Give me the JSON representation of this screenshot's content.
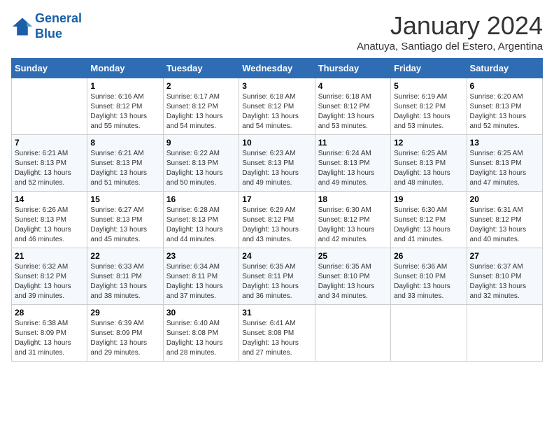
{
  "header": {
    "logo_line1": "General",
    "logo_line2": "Blue",
    "month": "January 2024",
    "location": "Anatuya, Santiago del Estero, Argentina"
  },
  "weekdays": [
    "Sunday",
    "Monday",
    "Tuesday",
    "Wednesday",
    "Thursday",
    "Friday",
    "Saturday"
  ],
  "weeks": [
    [
      {
        "day": "",
        "sunrise": "",
        "sunset": "",
        "daylight": ""
      },
      {
        "day": "1",
        "sunrise": "6:16 AM",
        "sunset": "8:12 PM",
        "daylight": "13 hours and 55 minutes."
      },
      {
        "day": "2",
        "sunrise": "6:17 AM",
        "sunset": "8:12 PM",
        "daylight": "13 hours and 54 minutes."
      },
      {
        "day": "3",
        "sunrise": "6:18 AM",
        "sunset": "8:12 PM",
        "daylight": "13 hours and 54 minutes."
      },
      {
        "day": "4",
        "sunrise": "6:18 AM",
        "sunset": "8:12 PM",
        "daylight": "13 hours and 53 minutes."
      },
      {
        "day": "5",
        "sunrise": "6:19 AM",
        "sunset": "8:12 PM",
        "daylight": "13 hours and 53 minutes."
      },
      {
        "day": "6",
        "sunrise": "6:20 AM",
        "sunset": "8:13 PM",
        "daylight": "13 hours and 52 minutes."
      }
    ],
    [
      {
        "day": "7",
        "sunrise": "6:21 AM",
        "sunset": "8:13 PM",
        "daylight": "13 hours and 52 minutes."
      },
      {
        "day": "8",
        "sunrise": "6:21 AM",
        "sunset": "8:13 PM",
        "daylight": "13 hours and 51 minutes."
      },
      {
        "day": "9",
        "sunrise": "6:22 AM",
        "sunset": "8:13 PM",
        "daylight": "13 hours and 50 minutes."
      },
      {
        "day": "10",
        "sunrise": "6:23 AM",
        "sunset": "8:13 PM",
        "daylight": "13 hours and 49 minutes."
      },
      {
        "day": "11",
        "sunrise": "6:24 AM",
        "sunset": "8:13 PM",
        "daylight": "13 hours and 49 minutes."
      },
      {
        "day": "12",
        "sunrise": "6:25 AM",
        "sunset": "8:13 PM",
        "daylight": "13 hours and 48 minutes."
      },
      {
        "day": "13",
        "sunrise": "6:25 AM",
        "sunset": "8:13 PM",
        "daylight": "13 hours and 47 minutes."
      }
    ],
    [
      {
        "day": "14",
        "sunrise": "6:26 AM",
        "sunset": "8:13 PM",
        "daylight": "13 hours and 46 minutes."
      },
      {
        "day": "15",
        "sunrise": "6:27 AM",
        "sunset": "8:13 PM",
        "daylight": "13 hours and 45 minutes."
      },
      {
        "day": "16",
        "sunrise": "6:28 AM",
        "sunset": "8:13 PM",
        "daylight": "13 hours and 44 minutes."
      },
      {
        "day": "17",
        "sunrise": "6:29 AM",
        "sunset": "8:12 PM",
        "daylight": "13 hours and 43 minutes."
      },
      {
        "day": "18",
        "sunrise": "6:30 AM",
        "sunset": "8:12 PM",
        "daylight": "13 hours and 42 minutes."
      },
      {
        "day": "19",
        "sunrise": "6:30 AM",
        "sunset": "8:12 PM",
        "daylight": "13 hours and 41 minutes."
      },
      {
        "day": "20",
        "sunrise": "6:31 AM",
        "sunset": "8:12 PM",
        "daylight": "13 hours and 40 minutes."
      }
    ],
    [
      {
        "day": "21",
        "sunrise": "6:32 AM",
        "sunset": "8:12 PM",
        "daylight": "13 hours and 39 minutes."
      },
      {
        "day": "22",
        "sunrise": "6:33 AM",
        "sunset": "8:11 PM",
        "daylight": "13 hours and 38 minutes."
      },
      {
        "day": "23",
        "sunrise": "6:34 AM",
        "sunset": "8:11 PM",
        "daylight": "13 hours and 37 minutes."
      },
      {
        "day": "24",
        "sunrise": "6:35 AM",
        "sunset": "8:11 PM",
        "daylight": "13 hours and 36 minutes."
      },
      {
        "day": "25",
        "sunrise": "6:35 AM",
        "sunset": "8:10 PM",
        "daylight": "13 hours and 34 minutes."
      },
      {
        "day": "26",
        "sunrise": "6:36 AM",
        "sunset": "8:10 PM",
        "daylight": "13 hours and 33 minutes."
      },
      {
        "day": "27",
        "sunrise": "6:37 AM",
        "sunset": "8:10 PM",
        "daylight": "13 hours and 32 minutes."
      }
    ],
    [
      {
        "day": "28",
        "sunrise": "6:38 AM",
        "sunset": "8:09 PM",
        "daylight": "13 hours and 31 minutes."
      },
      {
        "day": "29",
        "sunrise": "6:39 AM",
        "sunset": "8:09 PM",
        "daylight": "13 hours and 29 minutes."
      },
      {
        "day": "30",
        "sunrise": "6:40 AM",
        "sunset": "8:08 PM",
        "daylight": "13 hours and 28 minutes."
      },
      {
        "day": "31",
        "sunrise": "6:41 AM",
        "sunset": "8:08 PM",
        "daylight": "13 hours and 27 minutes."
      },
      {
        "day": "",
        "sunrise": "",
        "sunset": "",
        "daylight": ""
      },
      {
        "day": "",
        "sunrise": "",
        "sunset": "",
        "daylight": ""
      },
      {
        "day": "",
        "sunrise": "",
        "sunset": "",
        "daylight": ""
      }
    ]
  ]
}
